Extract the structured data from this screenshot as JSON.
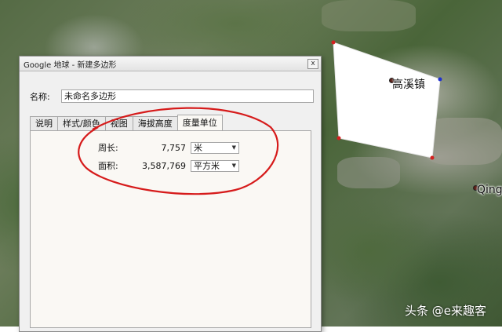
{
  "map": {
    "town_label": "高溪镇",
    "edge_label": "Qing",
    "watermark": "头条 @e来趣客"
  },
  "dialog": {
    "title": "Google 地球 - 新建多边形",
    "close_glyph": "x",
    "name_label": "名称:",
    "name_value": "未命名多边形",
    "tabs": [
      "说明",
      "样式/颜色",
      "视图",
      "海拔高度",
      "度量单位"
    ],
    "active_tab": "度量单位",
    "perimeter": {
      "label": "周长:",
      "value": "7,757",
      "unit": "米"
    },
    "area": {
      "label": "面积:",
      "value": "3,587,769",
      "unit": "平方米"
    }
  },
  "colors": {
    "polygon_fill": "#ffffff",
    "vertex": "#d42020",
    "vertex_selected": "#2030d0",
    "annotation": "#d61b1b"
  }
}
